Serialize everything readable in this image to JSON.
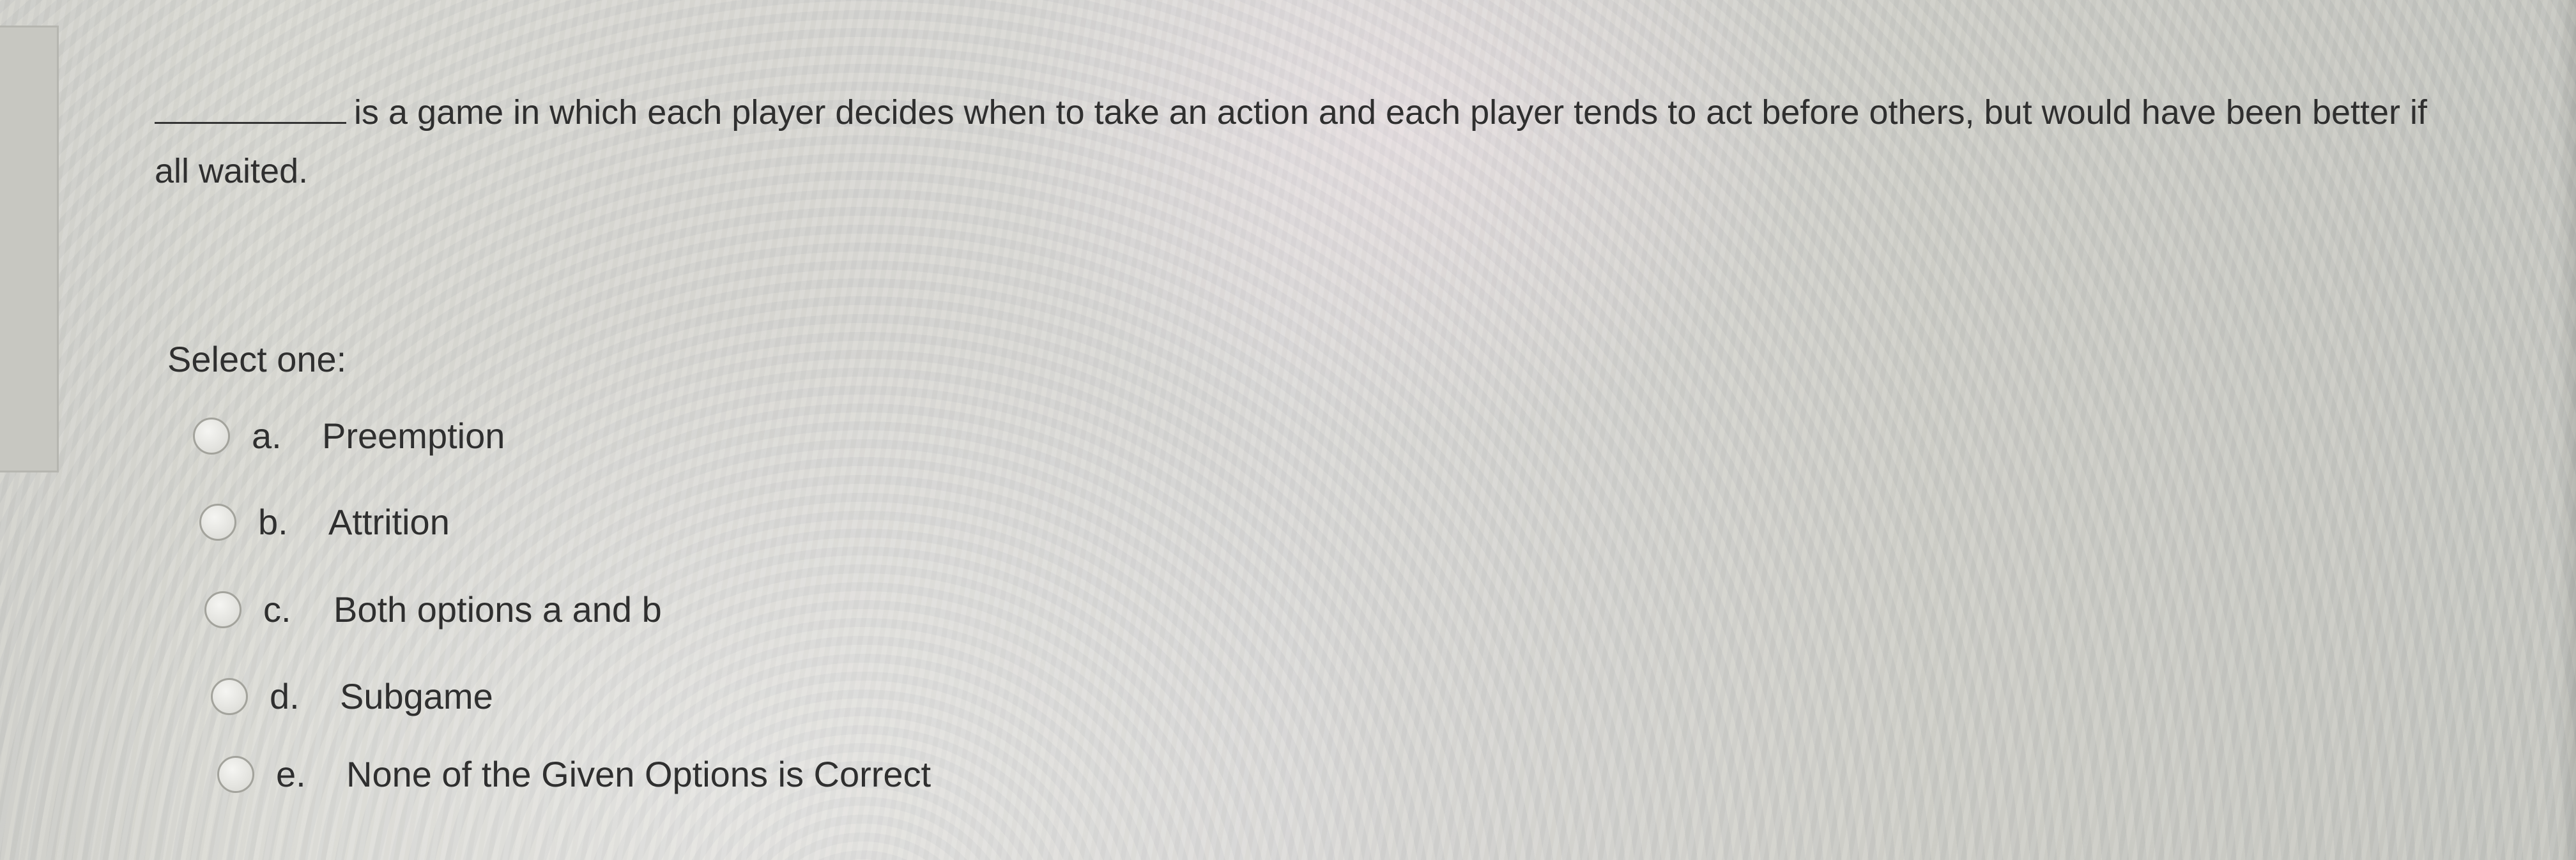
{
  "question": {
    "text": "is a game in which each player decides when to take an action and each player tends to act before others, but would have been better if all waited."
  },
  "select_label": "Select one:",
  "options": [
    {
      "letter": "a.",
      "label": "Preemption"
    },
    {
      "letter": "b.",
      "label": "Attrition"
    },
    {
      "letter": "c.",
      "label": "Both options a and b"
    },
    {
      "letter": "d.",
      "label": "Subgame"
    },
    {
      "letter": "e.",
      "label": "None of the Given Options is Correct"
    }
  ]
}
